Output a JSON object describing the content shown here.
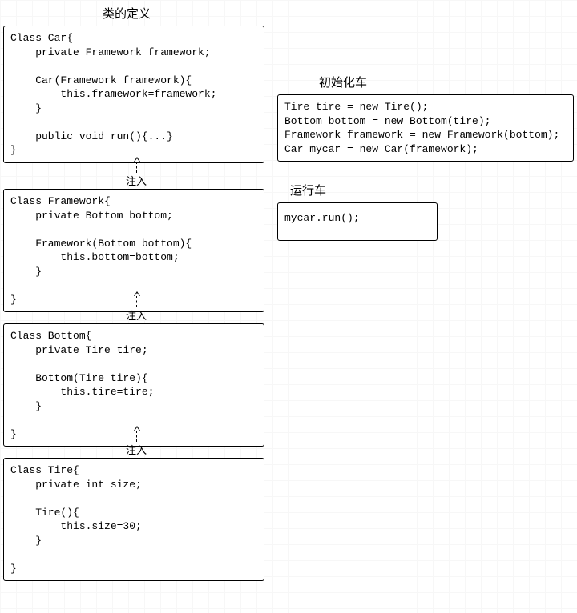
{
  "headings": {
    "class_def": "类的定义",
    "init_car": "初始化车",
    "run_car": "运行车"
  },
  "arrows": {
    "inject1": "注入",
    "inject2": "注入",
    "inject3": "注入"
  },
  "code": {
    "car": "Class Car{\n    private Framework framework;\n\n    Car(Framework framework){\n        this.framework=framework;\n    }\n\n    public void run(){...}\n}",
    "framework": "Class Framework{\n    private Bottom bottom;\n\n    Framework(Bottom bottom){\n        this.bottom=bottom;\n    }\n\n}",
    "bottom": "Class Bottom{\n    private Tire tire;\n\n    Bottom(Tire tire){\n        this.tire=tire;\n    }\n\n}",
    "tire": "Class Tire{\n    private int size;\n\n    Tire(){\n        this.size=30;\n    }\n\n}",
    "init": "Tire tire = new Tire();\nBottom bottom = new Bottom(tire);\nFramework framework = new Framework(bottom);\nCar mycar = new Car(framework);",
    "run": "mycar.run();"
  }
}
